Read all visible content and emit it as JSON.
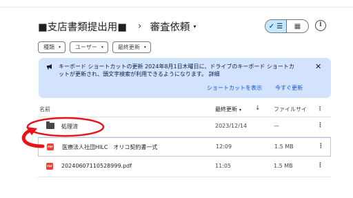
{
  "breadcrumb": {
    "parent": "■支店書類提出用■",
    "separator": "›",
    "current": "審査依頼",
    "current_caret": "▾"
  },
  "view_toggle": {
    "list_icon": "✓ ☰",
    "grid_icon": "▦",
    "selected": "list"
  },
  "info_icon": "i",
  "filters": [
    {
      "label": "種類",
      "caret": "▾"
    },
    {
      "label": "ユーザー",
      "caret": "▾"
    },
    {
      "label": "最終更新",
      "caret": "▾"
    }
  ],
  "banner": {
    "icon": "megaphone-icon",
    "text": "キーボード ショートカットの更新 2024年8月1日木曜日に、ドライブのキーボード ショートカットが更新され、頭文字検索が利用できるようになります。 詳細",
    "close": "✕",
    "link_shortcuts": "ショートカットを表示",
    "link_update": "今すぐ更新"
  },
  "table": {
    "col_name": "名前",
    "col_modified": "最終更新",
    "col_modified_caret": "▾",
    "sort_icon": "↓",
    "col_size": "ファイルサイ",
    "col_more": "⋮",
    "rows": [
      {
        "type": "folder",
        "name": "処理済",
        "modified": "2023/12/14",
        "size": "—",
        "more": "⋮"
      },
      {
        "type": "pdf",
        "name": "医療法人社団HILC　オリコ契約書一式",
        "modified": "12:09",
        "size": "1.5 MB",
        "more": "⋮"
      },
      {
        "type": "pdf",
        "name": "20240607110528999.pdf",
        "modified": "11:05",
        "size": "1.5 MB",
        "more": "⋮"
      }
    ]
  },
  "pdf_badge": "PDF",
  "colors": {
    "banner_bg": "#d3e3fd",
    "toggle_selected": "#c2e7ff",
    "link": "#0b57d0",
    "annotation": "#e8141a",
    "pdf": "#ea4335"
  }
}
